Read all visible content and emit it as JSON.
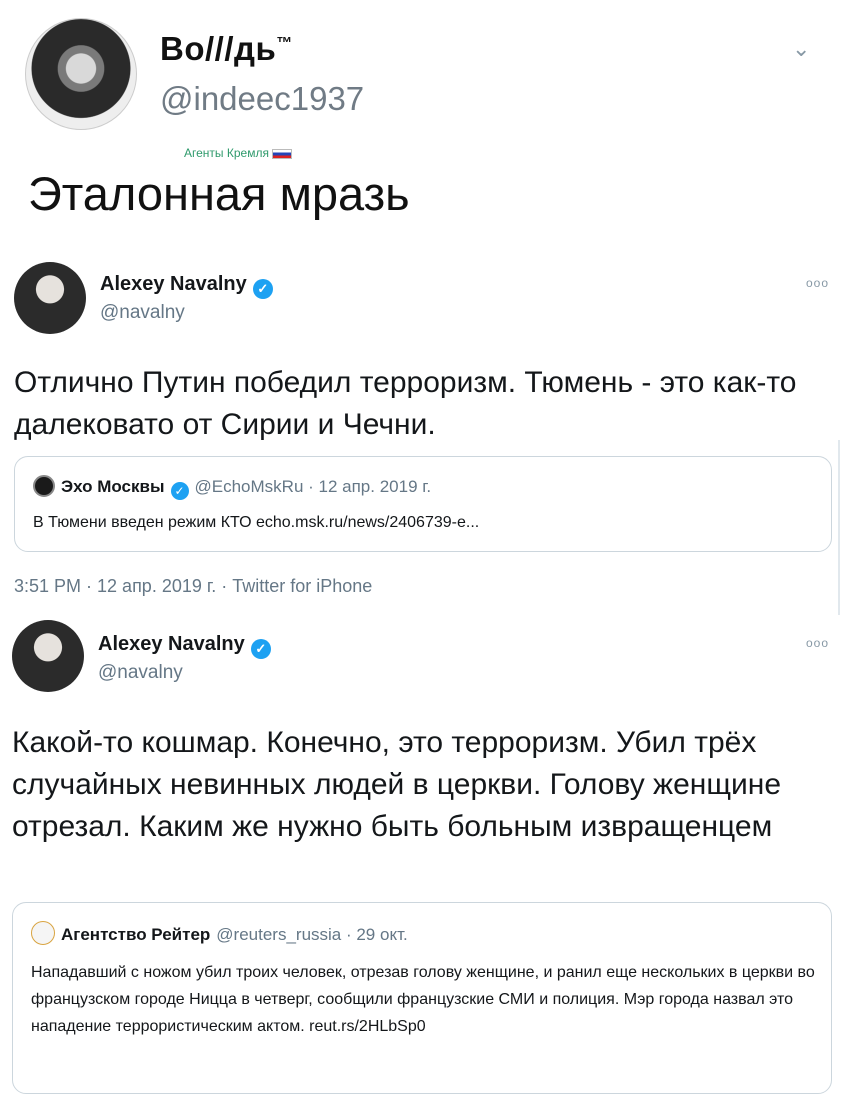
{
  "header": {
    "name": "Во///дь",
    "tm": "™",
    "handle": "@indeec1937",
    "subtitle": "Агенты Кремля",
    "title": "Эталонная мразь"
  },
  "tweets": [
    {
      "name": "Alexey Navalny",
      "handle": "@navalny",
      "more": "ooo",
      "text": "Отлично Путин победил терроризм. Тюмень - это как-то далековато от Сирии и Чечни.",
      "quote": {
        "name": "Эхо Москвы",
        "meta": "@EchoMskRu · 12 апр. 2019 г.",
        "text": "В Тюмени введен режим КТО echo.msk.ru/news/2406739-e..."
      },
      "timestamp": "3:51 PM · 12 апр. 2019 г. · Twitter for iPhone"
    },
    {
      "name": "Alexey Navalny",
      "handle": "@navalny",
      "more": "ooo",
      "text": "Какой-то кошмар. Конечно, это терроризм. Убил трёх случайных невинных людей в церкви. Голову женщине отрезал. Каким же нужно быть больным извращенцем",
      "quote": {
        "name": "Агентство Рейтер",
        "meta": "@reuters_russia · 29 окт.",
        "text": "Нападавший с ножом убил троих человек, отрезав голову женщине, и ранил еще нескольких в церкви во французском городе Ницца в четверг, сообщили французские СМИ и полиция. Мэр города назвал это нападение террористическим актом. reut.rs/2HLbSp0"
      }
    }
  ],
  "colors": {
    "verified": "#1da1f2",
    "secondary_text": "#657786",
    "subtitle_green": "#2f9a6c"
  }
}
